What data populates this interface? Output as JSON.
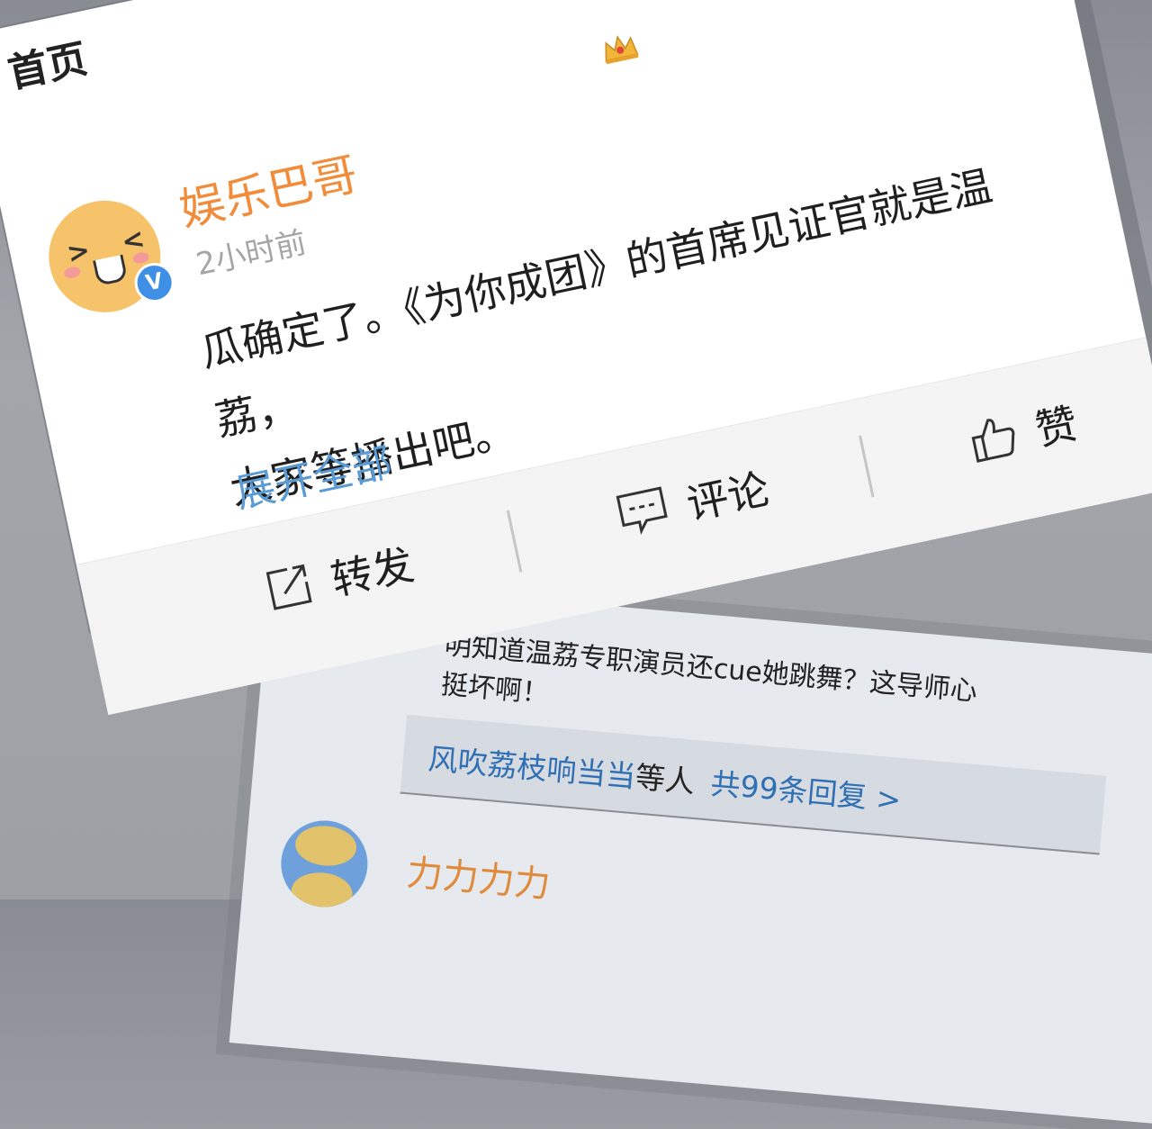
{
  "nav": {
    "title": "首页"
  },
  "post": {
    "username": "娱乐巴哥",
    "time": "2小时前",
    "text_line1": "瓜确定了。《为你成团》的首席见证官就是温荔，",
    "text_line2": "大家等播出吧。",
    "expand_label": "展开全部",
    "verified_mark": "V"
  },
  "actions": {
    "repost": "转发",
    "comment": "评论",
    "like": "赞"
  },
  "comments": {
    "text_line1": "明知道温荔专职演员还cue她跳舞？这导师心",
    "text_line2": "挺坏啊！",
    "reply_names": "风吹荔枝响当当",
    "reply_suffix": "等人",
    "reply_count": "共99条回复 >",
    "next_user": "力力力力"
  },
  "colors": {
    "username": "#f08c3a",
    "link": "#5b9bd5",
    "verified": "#3f8fe6"
  }
}
